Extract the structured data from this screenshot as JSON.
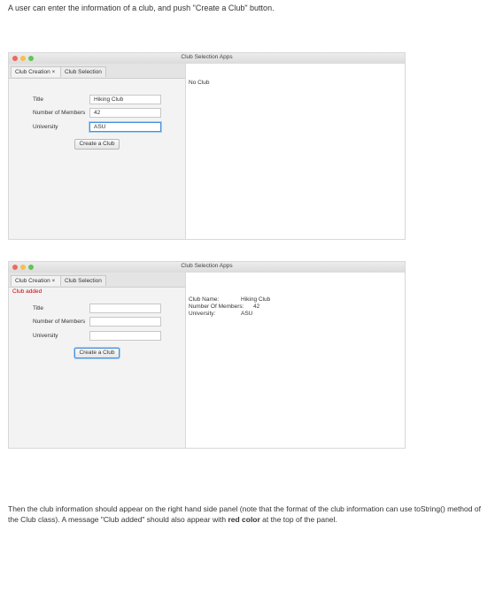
{
  "intro_text": "A user can enter the information of a club, and push \"Create a Club\" button.",
  "window_title": "Club Selection Apps",
  "tabs": {
    "creation": "Club Creation ×",
    "selection": "Club Selection"
  },
  "form_labels": {
    "title": "Title",
    "members": "Number of Members",
    "university": "University"
  },
  "button_label": "Create a Club",
  "window1": {
    "title_value": "Hiking Club",
    "members_value": "42",
    "university_value": "ASU",
    "right_text": "No Club"
  },
  "window2": {
    "status_message": "Club added",
    "title_value": "",
    "members_value": "",
    "university_value": "",
    "club_info": {
      "name_label": "Club Name:",
      "name_value": "Hiking Club",
      "members_label": "Number Of Members:",
      "members_value": "42",
      "university_label": "University:",
      "university_value": "ASU"
    }
  },
  "outro": {
    "part1": "Then the club information should appear on the right hand side panel (note that the format of the club information can use toString() method of the Club class). A message \"Club added\" should also appear with ",
    "bold": "red color",
    "part2": " at the top of the panel."
  }
}
